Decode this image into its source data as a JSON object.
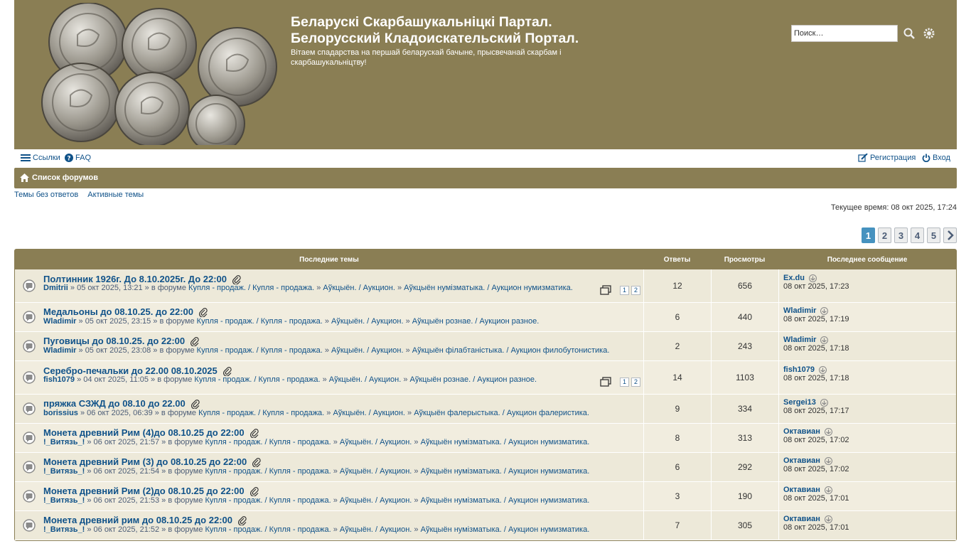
{
  "header": {
    "title_line1": "Беларускі Скарбашукальніцкі Партал.",
    "title_line2": "Белорусский Кладоискательский Портал.",
    "description": "Вітаем спадарства на першай беларускай бачыне, прысвечанай скарбам і скарбашукальніцтву!",
    "search_placeholder": "Поиск…"
  },
  "nav": {
    "links": "Ссылки",
    "faq": "FAQ",
    "register": "Регистрация",
    "login": "Вход"
  },
  "breadcrumb": {
    "home": "Список форумов"
  },
  "quick_links": {
    "unanswered": "Темы без ответов",
    "active": "Активные темы"
  },
  "current_time": "Текущее время: 08 окт 2025, 17:24",
  "pagination": {
    "pages": [
      "1",
      "2",
      "3",
      "4",
      "5"
    ],
    "active": "1"
  },
  "table": {
    "headers": {
      "topics": "Последние темы",
      "answers": "Ответы",
      "views": "Просмотры",
      "last": "Последнее сообщение"
    },
    "rows": [
      {
        "title": "Полтинник 1926г. До 8.10.2025г. До 22:00",
        "author": "Dmitrii",
        "date": "» 05 окт 2025, 13:21 » в форуме",
        "forum": "Купля - продаж. / Купля - продажа.",
        "sub": "Аўкцыён. / Аукцион.",
        "subsub": "Аўкцыён нумізматыка. / Аукцион нумизматика.",
        "pages": [
          "1",
          "2"
        ],
        "answers": "12",
        "views": "656",
        "last_author": "Ex.du",
        "last_time": "08 окт 2025, 17:23"
      },
      {
        "title": "Медальоны до 08.10.25. до 22:00",
        "author": "Wladimir",
        "date": "» 05 окт 2025, 23:15 » в форуме",
        "forum": "Купля - продаж. / Купля - продажа.",
        "sub": "Аўкцыён. / Аукцион.",
        "subsub": "Аўкцыён рознае. / Аукцион разное.",
        "pages": [],
        "answers": "6",
        "views": "440",
        "last_author": "Wladimir",
        "last_time": "08 окт 2025, 17:19"
      },
      {
        "title": "Пуговицы до 08.10.25. до 22:00",
        "author": "Wladimir",
        "date": "» 05 окт 2025, 23:08 » в форуме",
        "forum": "Купля - продаж. / Купля - продажа.",
        "sub": "Аўкцыён. / Аукцион.",
        "subsub": "Аўкцыён філабтаністыка. / Аукцион филобутонистика.",
        "pages": [],
        "answers": "2",
        "views": "243",
        "last_author": "Wladimir",
        "last_time": "08 окт 2025, 17:18"
      },
      {
        "title": "Серебро-печальки до 22.00 08.10.2025",
        "author": "fish1079",
        "date": "» 04 окт 2025, 11:05 » в форуме",
        "forum": "Купля - продаж. / Купля - продажа.",
        "sub": "Аўкцыён. / Аукцион.",
        "subsub": "Аўкцыён рознае. / Аукцион разное.",
        "pages": [
          "1",
          "2"
        ],
        "answers": "14",
        "views": "1103",
        "last_author": "fish1079",
        "last_time": "08 окт 2025, 17:18"
      },
      {
        "title": "пряжка СЗЖД до 08.10 до 22.00",
        "author": "borissius",
        "date": "» 06 окт 2025, 06:39 » в форуме",
        "forum": "Купля - продаж. / Купля - продажа.",
        "sub": "Аўкцыён. / Аукцион.",
        "subsub": "Аўкцыён фалерыстыка. / Аукцион фалеристика.",
        "pages": [],
        "answers": "9",
        "views": "334",
        "last_author": "Sergei13",
        "last_time": "08 окт 2025, 17:17"
      },
      {
        "title": "Монета древний Рим (4)до 08.10.25 до 22:00",
        "author": "!_Витязь_!",
        "date": "» 06 окт 2025, 21:57 » в форуме",
        "forum": "Купля - продаж. / Купля - продажа.",
        "sub": "Аўкцыён. / Аукцион.",
        "subsub": "Аўкцыён нумізматыка. / Аукцион нумизматика.",
        "pages": [],
        "answers": "8",
        "views": "313",
        "last_author": "Октавиан",
        "last_time": "08 окт 2025, 17:02"
      },
      {
        "title": "Монета древний Рим (3) до 08.10.25 до 22:00",
        "author": "!_Витязь_!",
        "date": "» 06 окт 2025, 21:54 » в форуме",
        "forum": "Купля - продаж. / Купля - продажа.",
        "sub": "Аўкцыён. / Аукцион.",
        "subsub": "Аўкцыён нумізматыка. / Аукцион нумизматика.",
        "pages": [],
        "answers": "6",
        "views": "292",
        "last_author": "Октавиан",
        "last_time": "08 окт 2025, 17:02"
      },
      {
        "title": "Монета древний Рим (2)до 08.10.25 до 22:00",
        "author": "!_Витязь_!",
        "date": "» 06 окт 2025, 21:53 » в форуме",
        "forum": "Купля - продаж. / Купля - продажа.",
        "sub": "Аўкцыён. / Аукцион.",
        "subsub": "Аўкцыён нумізматыка. / Аукцион нумизматика.",
        "pages": [],
        "answers": "3",
        "views": "190",
        "last_author": "Октавиан",
        "last_time": "08 окт 2025, 17:01"
      },
      {
        "title": "Монета древний рим до 08.10.25 до 22:00",
        "author": "!_Витязь_!",
        "date": "» 06 окт 2025, 21:52 » в форуме",
        "forum": "Купля - продаж. / Купля - продажа.",
        "sub": "Аўкцыён. / Аукцион.",
        "subsub": "Аўкцыён нумізматыка. / Аукцион нумизматика.",
        "pages": [],
        "answers": "7",
        "views": "305",
        "last_author": "Октавиан",
        "last_time": "08 окт 2025, 17:01"
      }
    ]
  }
}
